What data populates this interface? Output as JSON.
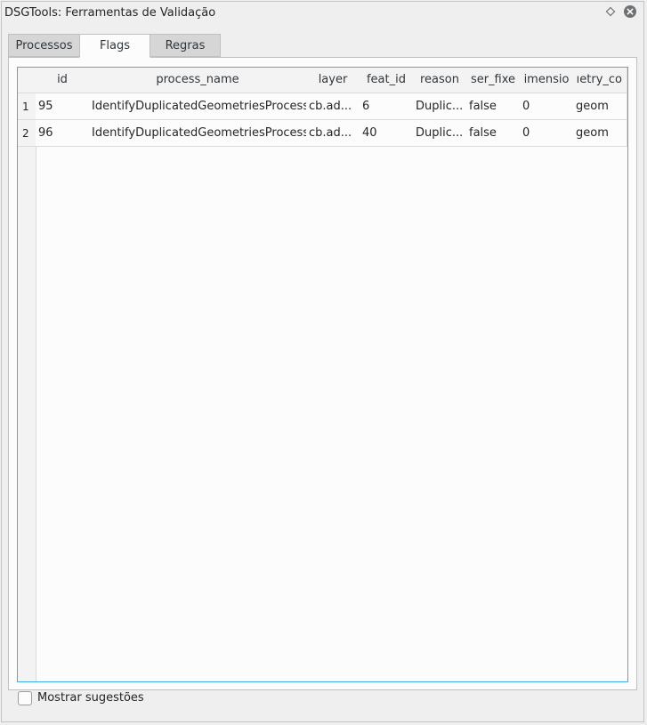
{
  "window": {
    "title": "DSGTools: Ferramentas de Validação",
    "float_icon": "float-diamond-icon",
    "close_icon": "close-circle-icon"
  },
  "tabs": [
    {
      "label": "Processos",
      "active": false
    },
    {
      "label": "Flags",
      "active": true
    },
    {
      "label": "Regras",
      "active": false
    }
  ],
  "table": {
    "headers": [
      "id",
      "process_name",
      "layer",
      "feat_id",
      "reason",
      "ser_fixe",
      "imensio",
      "ıetry_co"
    ],
    "rows": [
      {
        "num": "1",
        "cells": [
          "95",
          "IdentifyDuplicatedGeometriesProcess",
          "cb.ad...",
          "6",
          "Duplic...",
          "false",
          "0",
          "geom"
        ]
      },
      {
        "num": "2",
        "cells": [
          "96",
          "IdentifyDuplicatedGeometriesProcess",
          "cb.ad...",
          "40",
          "Duplic...",
          "false",
          "0",
          "geom"
        ]
      }
    ]
  },
  "suggestions": {
    "label": "Mostrar sugestões",
    "checked": false
  },
  "colors": {
    "accent": "#3daee9",
    "background": "#efefef",
    "close_button": "#6e7173"
  }
}
